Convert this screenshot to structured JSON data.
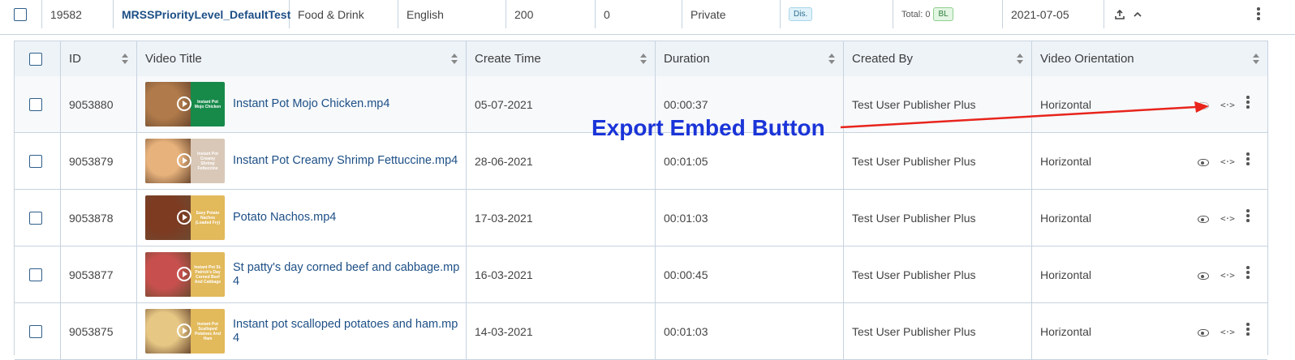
{
  "parent_row": {
    "id": "19582",
    "name": "MRSSPriorityLevel_DefaultTest",
    "category": "Food & Drink",
    "language": "English",
    "count_a": "200",
    "count_b": "0",
    "visibility": "Private",
    "status_tag": "Dis.",
    "total_label": "Total: 0",
    "total_tag": "BL",
    "date": "2021-07-05"
  },
  "table": {
    "headers": [
      "ID",
      "Video Title",
      "Create Time",
      "Duration",
      "Created By",
      "Video Orientation"
    ],
    "rows": [
      {
        "id": "9053880",
        "title": "Instant Pot Mojo Chicken.mp4",
        "thumb_text": "Instant Pot Mojo Chicken",
        "thumb_color": "#178a4a",
        "food_color": "#b07a4a",
        "create_time": "05-07-2021",
        "duration": "00:00:37",
        "created_by": "Test User Publisher Plus",
        "orientation": "Horizontal"
      },
      {
        "id": "9053879",
        "title": "Instant Pot Creamy Shrimp Fettuccine.mp4",
        "thumb_text": "Instant Pot Creamy Shrimp Fettuccine",
        "thumb_color": "#d9c8b8",
        "food_color": "#e7b27c",
        "create_time": "28-06-2021",
        "duration": "00:01:05",
        "created_by": "Test User Publisher Plus",
        "orientation": "Horizontal"
      },
      {
        "id": "9053878",
        "title": "Potato Nachos.mp4",
        "thumb_text": "Easy Potato Nachos (Loaded Fry)",
        "thumb_color": "#e2b95b",
        "food_color": "#7d3b22",
        "create_time": "17-03-2021",
        "duration": "00:01:03",
        "created_by": "Test User Publisher Plus",
        "orientation": "Horizontal"
      },
      {
        "id": "9053877",
        "title": "St patty's day corned beef and cabbage.mp4",
        "thumb_text": "Instant Pot St. Patrick's Day Corned Beef And Cabbage",
        "thumb_color": "#e2b95b",
        "food_color": "#c7504e",
        "create_time": "16-03-2021",
        "duration": "00:00:45",
        "created_by": "Test User Publisher Plus",
        "orientation": "Horizontal"
      },
      {
        "id": "9053875",
        "title": "Instant pot scalloped potatoes and ham.mp4",
        "thumb_text": "Instant Pot Scalloped Potatoes And Ham",
        "thumb_color": "#e2b95b",
        "food_color": "#e6c784",
        "create_time": "14-03-2021",
        "duration": "00:01:03",
        "created_by": "Test User Publisher Plus",
        "orientation": "Horizontal"
      }
    ]
  },
  "annotation": {
    "label": "Export Embed Button",
    "color": "#1a34d8",
    "arrow_color": "#e8241c"
  },
  "icons": [
    "upload-icon",
    "chevron-up-icon",
    "kebab-icon",
    "eye-icon",
    "embed-code-icon",
    "play-icon",
    "sort-icon"
  ]
}
